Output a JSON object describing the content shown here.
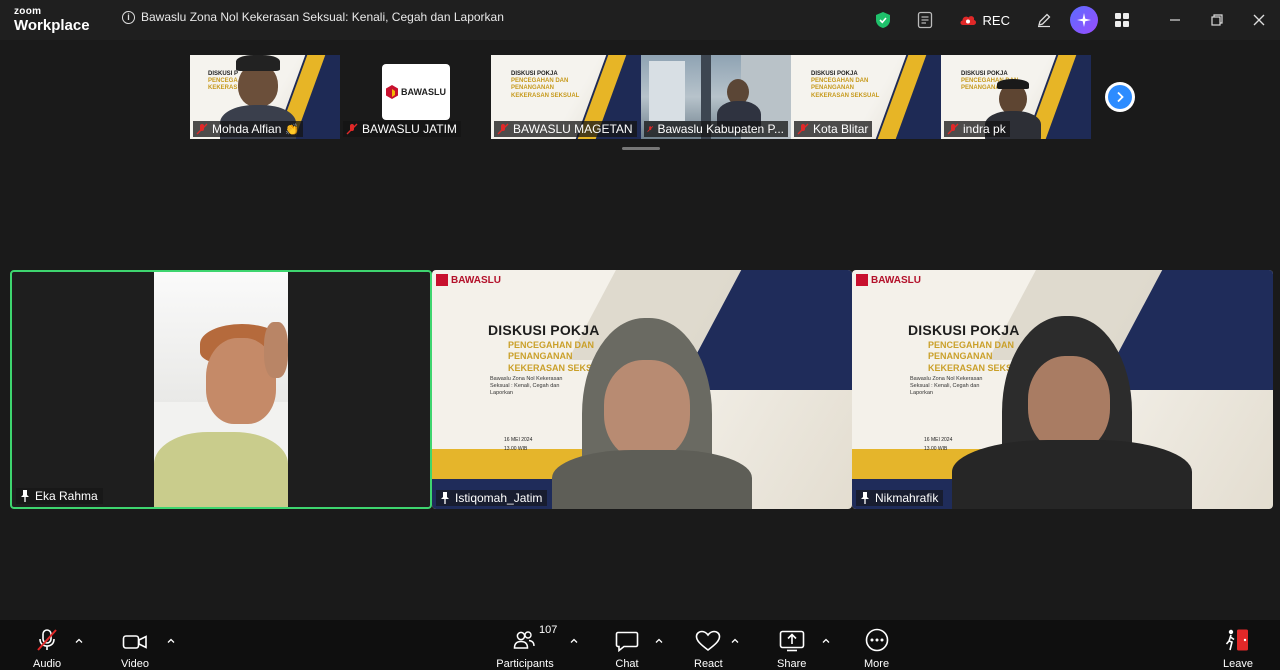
{
  "app": {
    "logo_top": "zoom",
    "logo_bottom": "Workplace"
  },
  "meeting": {
    "title": "Bawaslu Zona Nol Kekerasan Seksual: Kenali, Cegah dan Laporkan"
  },
  "titlebar": {
    "rec_label": "REC"
  },
  "thumbnails": [
    {
      "name": "Mohda Alfian",
      "emoji": "👏",
      "muted": true,
      "type": "slide-person"
    },
    {
      "name": "BAWASLU JATIM",
      "muted": true,
      "type": "logo"
    },
    {
      "name": "BAWASLU MAGETAN",
      "muted": true,
      "type": "slide"
    },
    {
      "name": "Bawaslu Kabupaten P...",
      "muted": true,
      "type": "office"
    },
    {
      "name": "Kota Blitar",
      "muted": true,
      "type": "slide"
    },
    {
      "name": "indra pk",
      "muted": true,
      "type": "slide-person"
    }
  ],
  "logo_tile": {
    "brand": "BAWASLU"
  },
  "slide": {
    "brand": "BAWASLU",
    "title": "DISKUSI POKJA",
    "subtitle_1": "PENCEGAHAN DAN",
    "subtitle_2": "PENANGANAN",
    "subtitle_3": "KEKERASAN SEKSUAL",
    "desc": "Bawaslu Zona Nol Kekerasan Seksual : Kenali, Cegah dan Laporkan",
    "date": "16 MEI 2024",
    "time": "13.00 WIB"
  },
  "gallery": [
    {
      "name": "Eka Rahma",
      "pinned": true,
      "active": true
    },
    {
      "name": "Istiqomah_Jatim",
      "pinned": true,
      "active": false
    },
    {
      "name": "Nikmahrafik",
      "pinned": true,
      "active": false
    }
  ],
  "toolbar": {
    "audio": "Audio",
    "video": "Video",
    "participants": "Participants",
    "participants_count": "107",
    "chat": "Chat",
    "react": "React",
    "share": "Share",
    "more": "More",
    "leave": "Leave"
  },
  "colors": {
    "active_speaker": "#3ed56f",
    "share_accent": "#2d8cff",
    "leave": "#e02828",
    "mute": "#e02828"
  }
}
